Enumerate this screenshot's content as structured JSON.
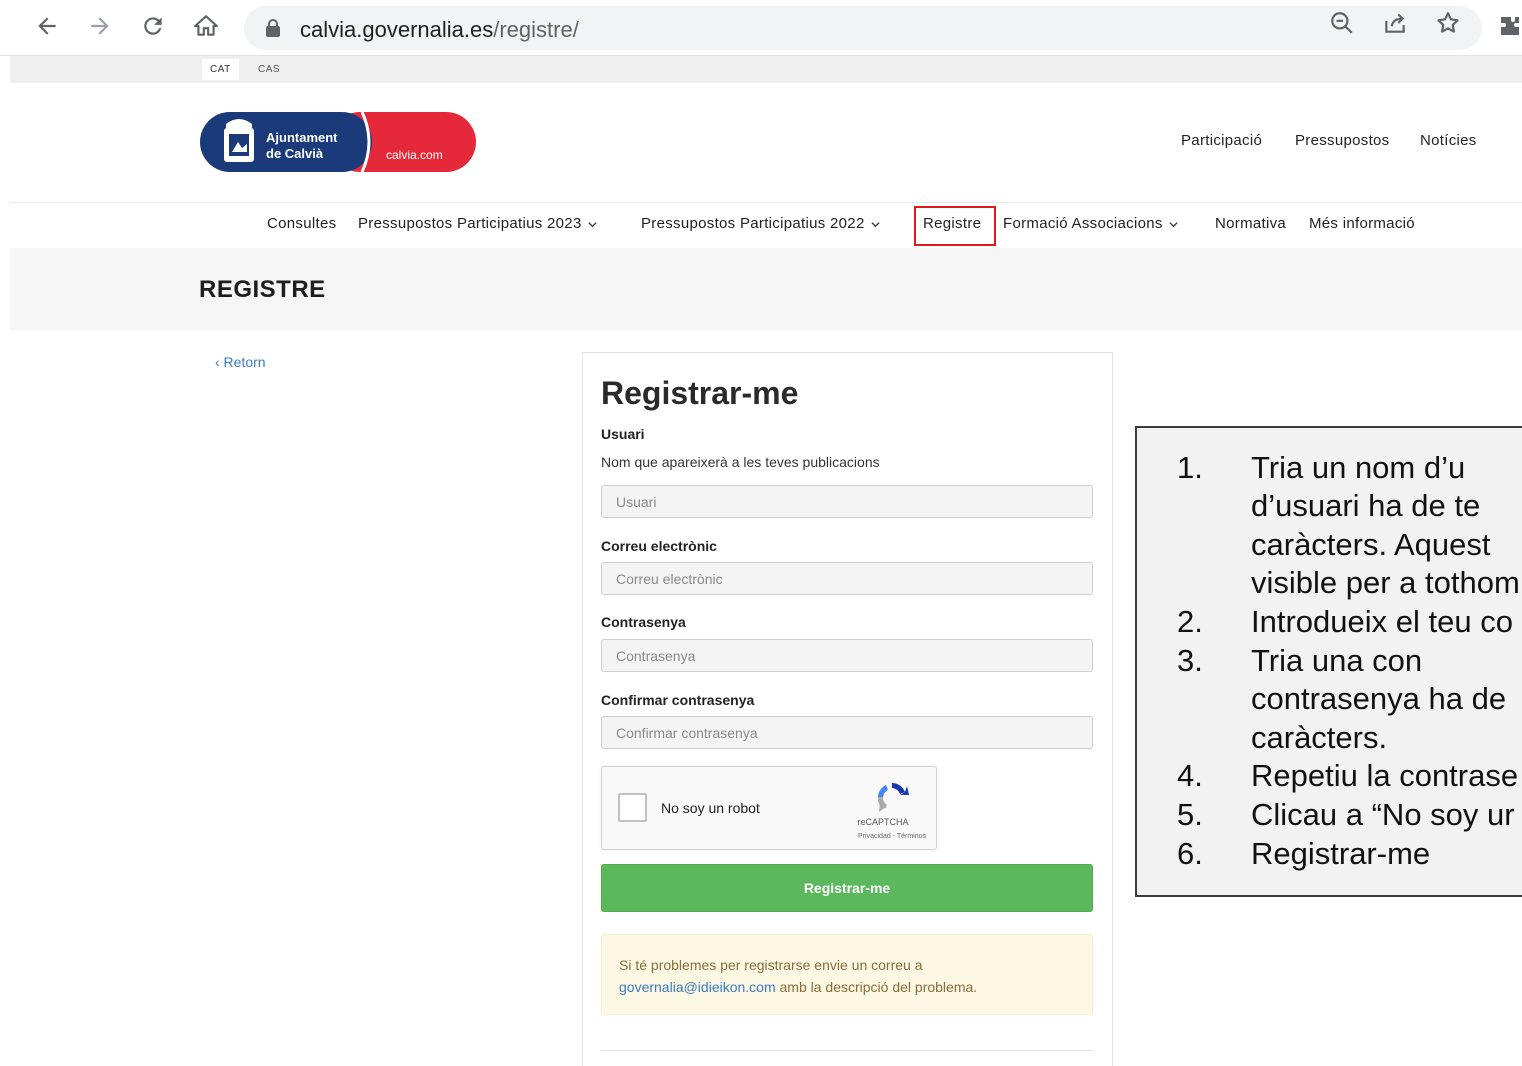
{
  "browser": {
    "url_host": "calvia.governalia.es",
    "url_path": "/registre/"
  },
  "lang": {
    "cat": "CAT",
    "cas": "CAS"
  },
  "logo": {
    "name_line1": "Ajuntament",
    "name_line2": "de Calvià",
    "site": "calvia.com",
    "colors": {
      "blue": "#1a3a7a",
      "red": "#e5293a"
    }
  },
  "top_menu": [
    "Participació",
    "Pressupostos",
    "Notícies"
  ],
  "main_nav": [
    {
      "label": "Consultes"
    },
    {
      "label": "Pressupostos Participatius 2023"
    },
    {
      "label": "Pressupostos Participatius 2022"
    },
    {
      "label": "Registre"
    },
    {
      "label": "Formació Associacions"
    },
    {
      "label": "Normativa"
    },
    {
      "label": "Més informació"
    }
  ],
  "page": {
    "title": "REGISTRE",
    "back": "‹ Retorn"
  },
  "form": {
    "title": "Registrar-me",
    "user_label": "Usuari",
    "user_help": "Nom que apareixerà a les teves publicacions",
    "user_placeholder": "Usuari",
    "email_label": "Correu electrònic",
    "email_placeholder": "Correu electrònic",
    "password_label": "Contrasenya",
    "password_placeholder": "Contrasenya",
    "confirm_label": "Confirmar contrasenya",
    "confirm_placeholder": "Confirmar contrasenya",
    "captcha_text": "No soy un robot",
    "captcha_brand": "reCAPTCHA",
    "captcha_links": "Privacidad - Términos",
    "submit": "Registrar-me",
    "alert_text": "Si té problemes per registrarse envie un correu a",
    "alert_email": "governalia@idieikon.com",
    "alert_text2": " amb la descripció del problema.",
    "submit_color": "#5cb85c"
  },
  "instructions": {
    "numbers": [
      "1.",
      "2.",
      "3.",
      "4.",
      "5.",
      "6."
    ],
    "lines": [
      "Tria   un   nom   d’u",
      "d’usuari   ha   de   te",
      "caràcters.   Aquest",
      "visible per a tothom",
      "Introdueix el teu co",
      "Tria       una       con",
      "contrasenya ha de",
      "caràcters.",
      "Repetiu la contrase",
      "Clicau a “No soy ur",
      "Registrar-me"
    ]
  }
}
